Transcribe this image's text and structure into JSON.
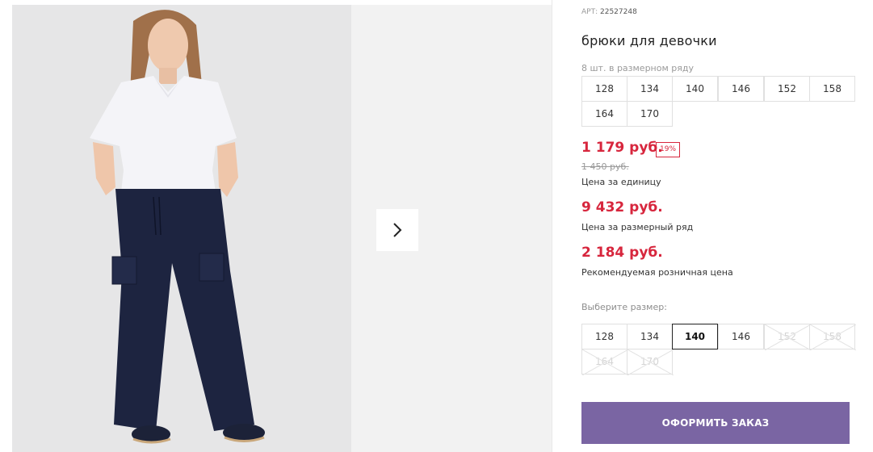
{
  "product": {
    "art_label": "АРТ:",
    "art_value": "22527248",
    "title": "брюки для девочки",
    "pack_label": "8 шт. в размерном ряду",
    "pack_sizes": [
      "128",
      "134",
      "140",
      "146",
      "152",
      "158",
      "164",
      "170"
    ]
  },
  "pricing": {
    "price": "1 179 руб.",
    "discount": "19%",
    "old_price": "1 450 руб.",
    "unit_label": "Цена за единицу",
    "pack_price": "9 432 руб.",
    "pack_price_label": "Цена за размерный ряд",
    "rrp": "2 184 руб.",
    "rrp_label": "Рекомендуемая розничная цена"
  },
  "size_select": {
    "label": "Выберите размер:",
    "sizes": [
      {
        "label": "128",
        "state": "available"
      },
      {
        "label": "134",
        "state": "available"
      },
      {
        "label": "140",
        "state": "selected"
      },
      {
        "label": "146",
        "state": "available"
      },
      {
        "label": "152",
        "state": "unavailable"
      },
      {
        "label": "158",
        "state": "unavailable"
      },
      {
        "label": "164",
        "state": "unavailable"
      },
      {
        "label": "170",
        "state": "unavailable"
      }
    ]
  },
  "order_button": "ОФОРМИТЬ ЗАКАЗ",
  "icons": {
    "next": "chevron-right-icon"
  },
  "colors": {
    "accent": "#d7263d",
    "button": "#7a65a3",
    "gallery_bg": "#f2f2f2"
  }
}
